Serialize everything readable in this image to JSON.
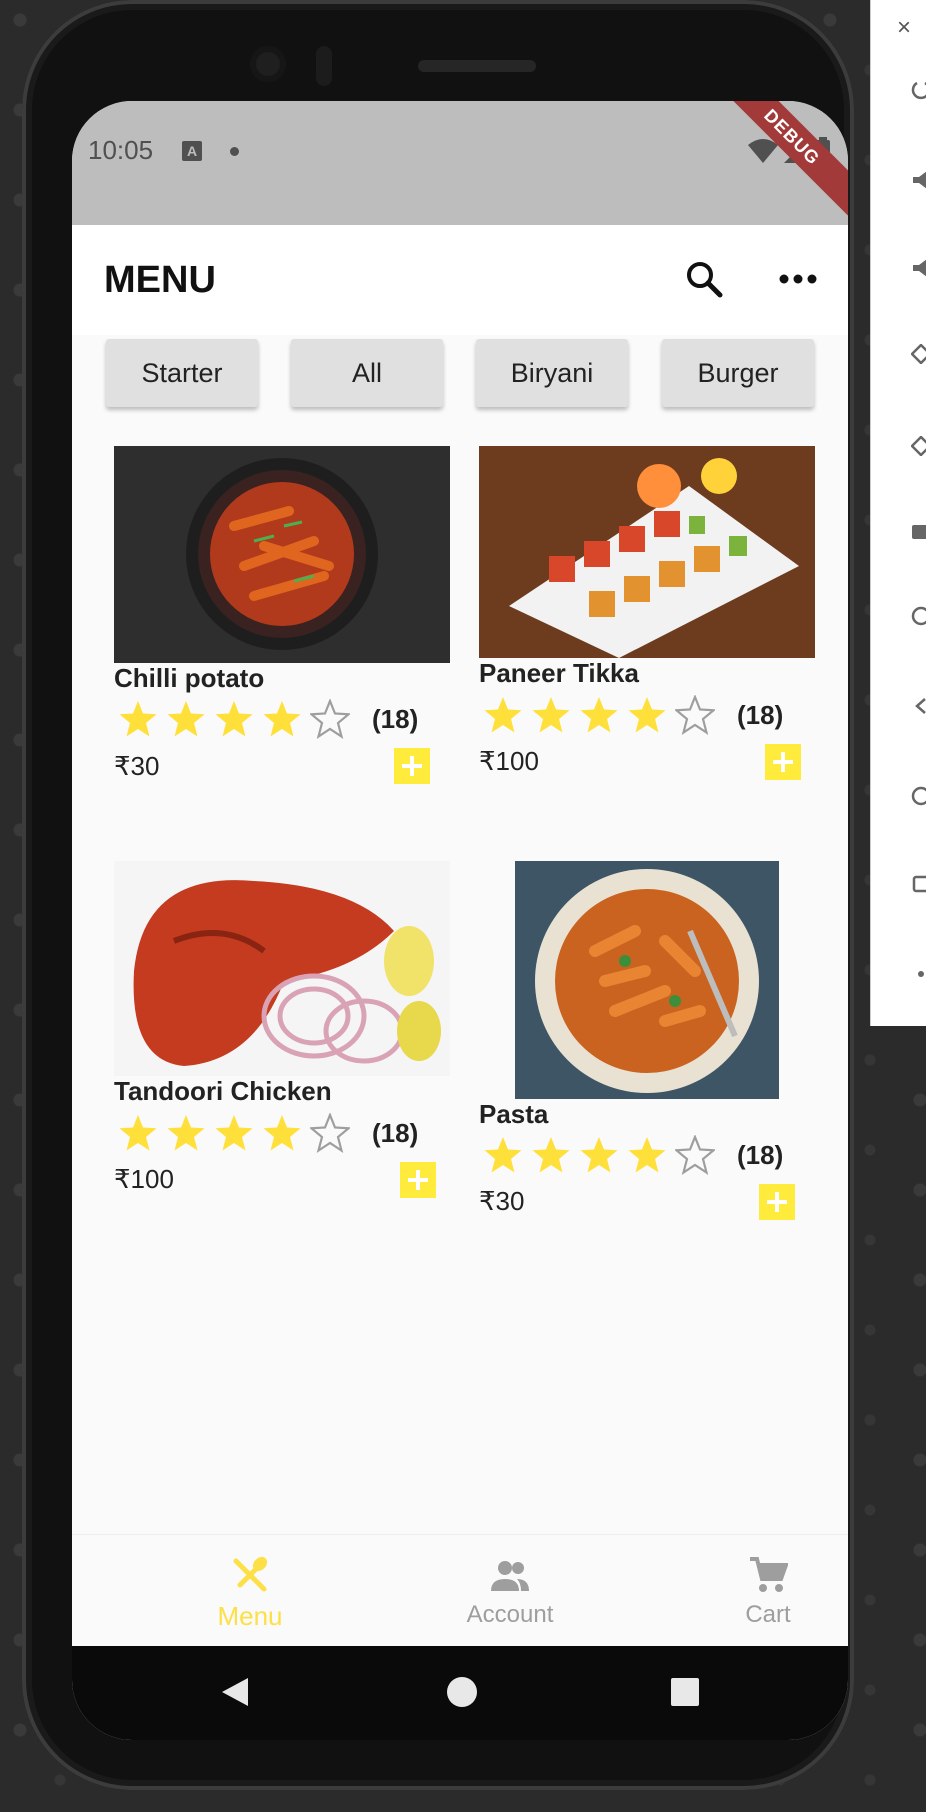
{
  "status_bar": {
    "time": "10:05",
    "debug_label": "DEBUG"
  },
  "app_bar": {
    "title": "MENU"
  },
  "categories": [
    "Starter",
    "All",
    "Biryani",
    "Burger"
  ],
  "items": [
    {
      "name": "Chilli potato",
      "rating_count": "(18)",
      "price": "₹30",
      "stars": 4
    },
    {
      "name": "Paneer Tikka",
      "rating_count": "(18)",
      "price": "₹100",
      "stars": 4
    },
    {
      "name": "Tandoori Chicken",
      "rating_count": "(18)",
      "price": "₹100",
      "stars": 4
    },
    {
      "name": "Pasta",
      "rating_count": "(18)",
      "price": "₹30",
      "stars": 4
    }
  ],
  "bottom_nav": [
    {
      "label": "Menu",
      "icon": "fork-knife-icon",
      "active": true
    },
    {
      "label": "Account",
      "icon": "people-icon",
      "active": false
    },
    {
      "label": "Cart",
      "icon": "cart-icon",
      "active": false
    }
  ],
  "colors": {
    "accent": "#ffeb3b",
    "star": "#ffe03a",
    "nav_active": "#fde047",
    "nav_inactive": "#9e9e9e"
  },
  "side_panel": {
    "close_label": "×"
  }
}
